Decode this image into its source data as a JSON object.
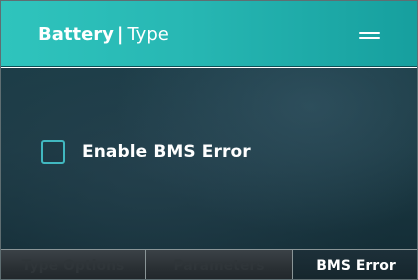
{
  "header": {
    "title_main": "Battery",
    "separator": "|",
    "title_sub": "Type",
    "menu_icon": "hamburger-menu-icon"
  },
  "content": {
    "checkbox": {
      "label": "Enable BMS Error",
      "checked": false
    }
  },
  "tabs": [
    {
      "label": "Type Options",
      "active": false
    },
    {
      "label": "Parameters",
      "active": false
    },
    {
      "label": "BMS Error",
      "active": true
    }
  ],
  "colors": {
    "header_accent": "#27b7b3",
    "content_background": "#1b3943",
    "checkbox_border": "#41b8c0",
    "active_tab_text": "#ffffff",
    "inactive_tab_text": "#2f3539"
  }
}
